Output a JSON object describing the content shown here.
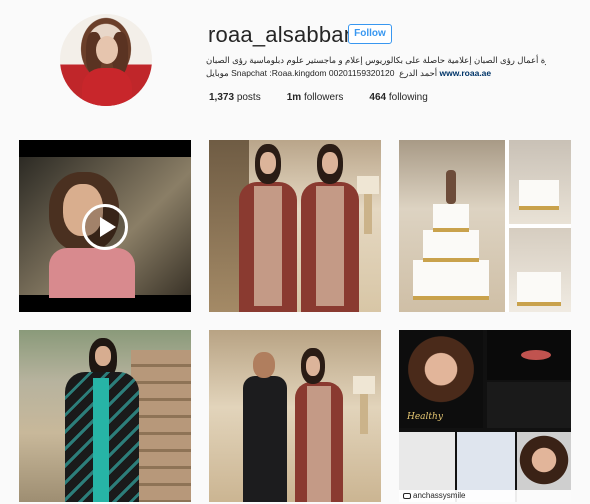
{
  "profile": {
    "username": "roaa_alsabban",
    "follow_label": "Follow",
    "bio_lines": [
      "إدارة أعمال رؤى الصبان إعلامية حاصلة على بكالوريوس إعلام و ماجستير علوم دبلوماسية رؤى الصبان",
      "موبايل Snapchat :Roaa.kingdom 00201159320120 ​ أحمد الدرع"
    ],
    "website": "www.roaa.ae"
  },
  "stats": {
    "posts_count": "1,373",
    "posts_label": "posts",
    "followers_count": "1m",
    "followers_label": "followers",
    "following_count": "464",
    "following_label": "following"
  },
  "posts": [
    {
      "type": "video",
      "icon": "play-icon"
    },
    {
      "type": "photo"
    },
    {
      "type": "photo"
    },
    {
      "type": "photo"
    },
    {
      "type": "photo"
    },
    {
      "type": "photo",
      "magazine_title": "Healthy",
      "repost_user": "anchassysmile"
    }
  ]
}
